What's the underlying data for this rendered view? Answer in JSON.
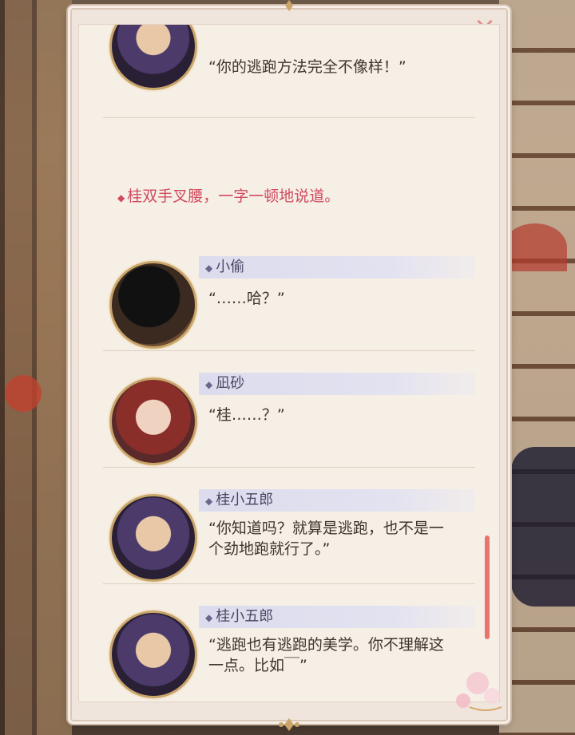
{
  "close_label": "×",
  "entries": [
    {
      "speaker": "",
      "line": "“你的逃跑方法完全不像样！”",
      "avatar": "katsura-portrait"
    },
    {
      "narration": "桂双手叉腰，一字一顿地说道。"
    },
    {
      "speaker": "小偷",
      "line": "“……哈？”",
      "avatar": "silhouette-portrait"
    },
    {
      "speaker": "凪砂",
      "line": "“桂……？”",
      "avatar": "nagisa-portrait"
    },
    {
      "speaker": "桂小五郎",
      "line": "“你知道吗？就算是逃跑，也不是一个劲地跑就行了。”",
      "avatar": "katsura-portrait"
    },
    {
      "speaker": "桂小五郎",
      "line": "“逃跑也有逃跑的美学。你不理解这一点。比如￣”",
      "avatar": "katsura-portrait"
    }
  ],
  "colors": {
    "narration": "#d04b5e",
    "name_bar": "#dcdcee",
    "frame": "#efe5dc",
    "scrollbar": "#e8746e",
    "avatar_border": "#c9a56a"
  },
  "icons": [
    "close-icon",
    "diamond-bullet-icon",
    "sakura-decoration-icon"
  ]
}
